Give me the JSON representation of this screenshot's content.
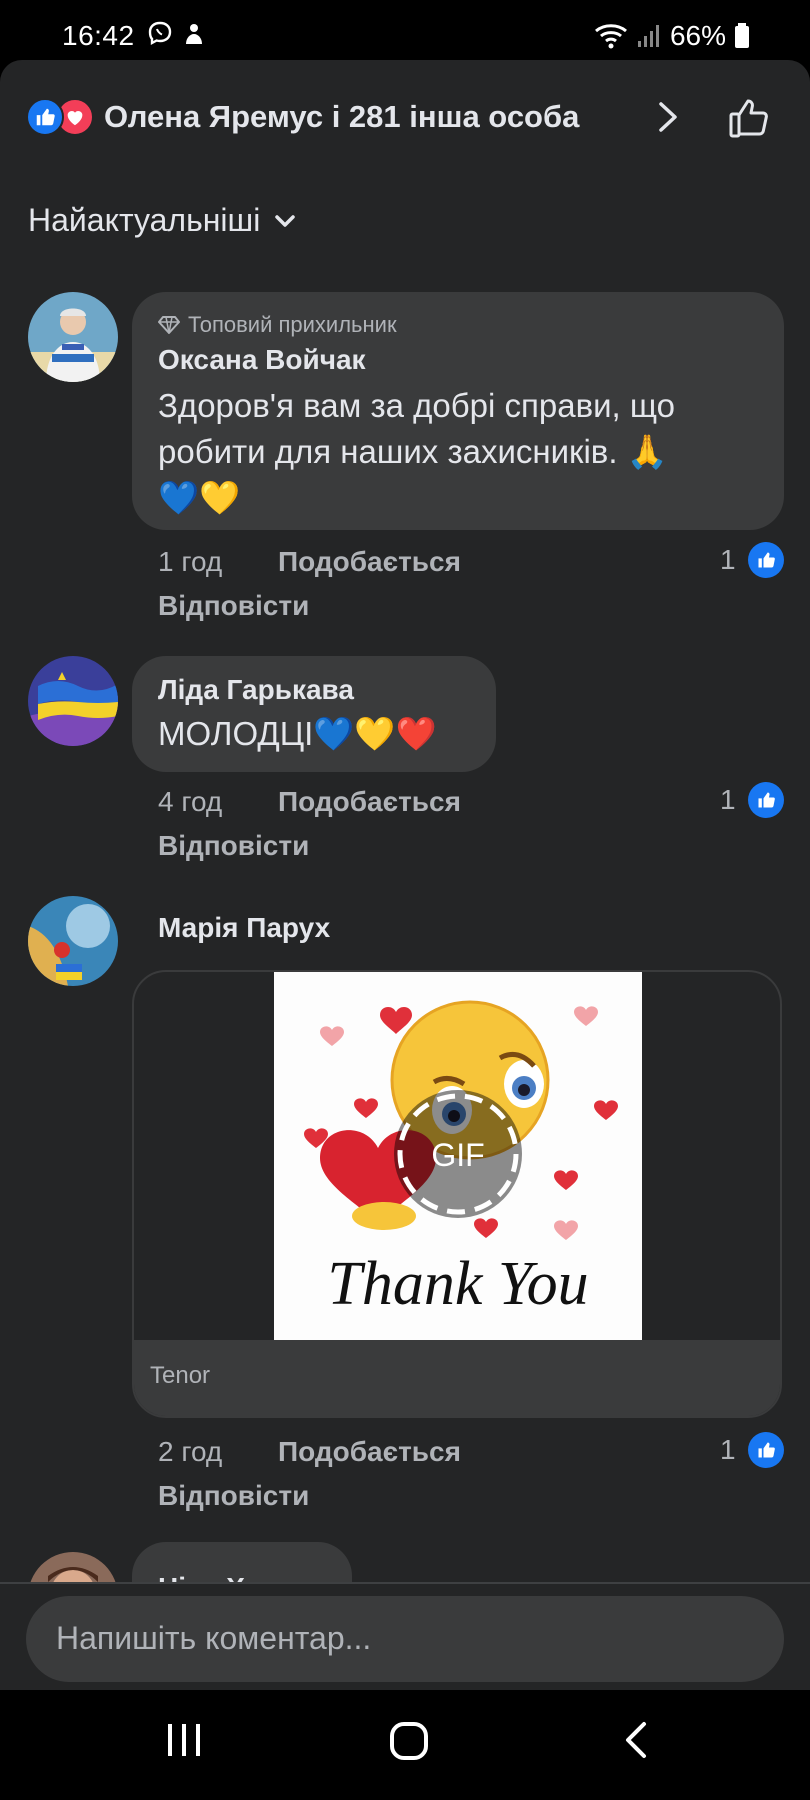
{
  "status_bar": {
    "time": "16:42",
    "battery": "66%",
    "icons": [
      "viber-icon",
      "notification-icon",
      "wifi-icon",
      "signal-icon",
      "battery-icon"
    ]
  },
  "header": {
    "reactions_text": "Олена Яремус і 281 інша особа",
    "reaction_icons": [
      "like-reaction-icon",
      "love-reaction-icon"
    ]
  },
  "sort": {
    "label": "Найактуальніші"
  },
  "comments": [
    {
      "badge": "Топовий прихильник",
      "author": "Оксана Войчак",
      "text_line1": "Здоров'я вам за добрі справи, що",
      "text_line2": "робити для наших захисників. 🙏",
      "text_line3": "💙💛",
      "time": "1 год",
      "like_label": "Подобається",
      "reply_label": "Відповісти",
      "likes": "1"
    },
    {
      "author": "Ліда Гарькава",
      "text": "МОЛОДЦІ💙💛❤️",
      "time": "4 год",
      "like_label": "Подобається",
      "reply_label": "Відповісти",
      "likes": "1"
    },
    {
      "author": "Марія Парух",
      "gif_label": "GIF",
      "gif_caption": "Thank You",
      "gif_source": "Tenor",
      "time": "2 год",
      "like_label": "Подобається",
      "reply_label": "Відповісти",
      "likes": "1"
    },
    {
      "author": "Ніна Хмель"
    }
  ],
  "composer": {
    "placeholder": "Напишіть коментар..."
  },
  "colors": {
    "background": "#242526",
    "bubble": "#3a3b3c",
    "accent_blue": "#1877f2",
    "love_red": "#f33e58",
    "text_primary": "#e4e6eb",
    "text_secondary": "#b0b3b8"
  }
}
